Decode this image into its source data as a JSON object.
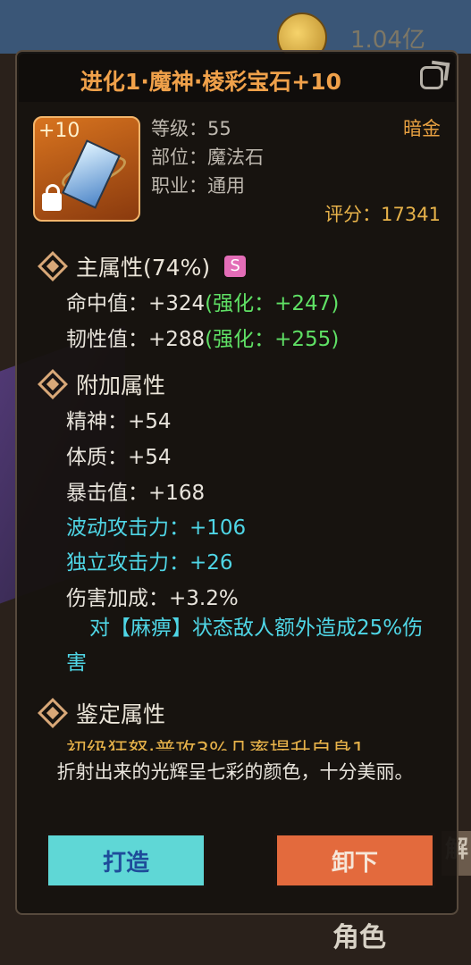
{
  "background": {
    "currency_amount": "1.04亿",
    "right_tab_label": "解",
    "bottom_tab_label": "角色"
  },
  "item": {
    "title": "进化1·魔神·棱彩宝石+10",
    "enhance_level": "+10",
    "level_label": "等级：55",
    "slot_label": "部位：魔法石",
    "class_label": "职业：通用",
    "rarity": "暗金",
    "score_label": "评分：17341"
  },
  "main_attributes": {
    "heading": "主属性(74%)",
    "grade_badge": "S",
    "lines": [
      {
        "text": "命中值：+324",
        "bonus": "(强化：+247)"
      },
      {
        "text": "韧性值：+288",
        "bonus": "(强化：+255)"
      }
    ]
  },
  "extra_attributes": {
    "heading": "附加属性",
    "lines": [
      "精神：+54",
      "体质：+54",
      "暴击值：+168",
      "波动攻击力：+106",
      "独立攻击力：+26",
      "伤害加成：+3.2%"
    ],
    "special_effect": "对【麻痹】状态敌人额外造成25%伤害"
  },
  "identify_attributes": {
    "heading": "鉴定属性",
    "partial_line": "初级狂怒·普攻3%几率提升自身1"
  },
  "description": "折射出来的光辉呈七彩的颜色，十分美丽。",
  "buttons": {
    "forge": "打造",
    "unequip": "卸下"
  },
  "colors": {
    "title": "#f0a14a",
    "rarity": "#e7a041",
    "enhance_bonus": "#5fe065",
    "special_stat": "#4fd6e6",
    "forge_button": "#5fd7d6",
    "unequip_button": "#e36a3d"
  }
}
